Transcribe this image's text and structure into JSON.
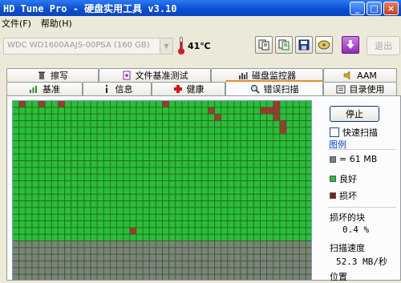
{
  "window": {
    "title": "HD Tune Pro - 硬盘实用工具 v3.10",
    "min": "_",
    "max": "□",
    "close": "×"
  },
  "menu": [
    "文件(F)",
    "帮助(H)"
  ],
  "toolbar": {
    "drive": "WDC WD1600AAJS-00PSA (160 GB)",
    "temperature": "41℃",
    "exit_label": "退出",
    "buttons": [
      "copy-icon",
      "copy-alt-icon",
      "save-icon",
      "disk-info-icon",
      "download-icon"
    ]
  },
  "tabs": {
    "back": [
      {
        "label": "擦写",
        "icon": "trash-icon"
      },
      {
        "label": "文件基准测试",
        "icon": "file-test-icon"
      },
      {
        "label": "磁盘监控器",
        "icon": "monitor-icon"
      },
      {
        "label": "AAM",
        "icon": "speaker-icon"
      }
    ],
    "front": [
      {
        "label": "基准",
        "icon": "benchmark-icon"
      },
      {
        "label": "信息",
        "icon": "info-icon"
      },
      {
        "label": "健康",
        "icon": "health-icon"
      },
      {
        "label": "错误扫描",
        "icon": "scan-icon",
        "active": true
      },
      {
        "label": "目录使用",
        "icon": "folder-icon"
      }
    ]
  },
  "scan": {
    "stop_label": "停止",
    "quick_scan_label": "快速扫描",
    "quick_scan_checked": false,
    "legend_title": "图例",
    "legend": [
      {
        "label": "= 61 MB",
        "color": "#808080"
      },
      {
        "label": "良好",
        "color": "#26c03a"
      },
      {
        "label": "损坏",
        "color": "#8b1a1a"
      }
    ],
    "damaged_label": "损坏的块",
    "damaged_value": "0.4 %",
    "speed_label": "扫描速度",
    "speed_value": "52.3 MB/秒",
    "position_label": "位置"
  },
  "colors": {
    "good": "#26c03a",
    "bad": "#a83434",
    "unscanned": "#808080",
    "grid": "#2e6a1e"
  },
  "grid_data": {
    "columns": 46,
    "rows": 27,
    "scanned_rows": 21,
    "bad_blocks": [
      [
        0,
        1
      ],
      [
        0,
        4
      ],
      [
        0,
        7
      ],
      [
        0,
        23
      ],
      [
        0,
        40
      ],
      [
        1,
        30
      ],
      [
        1,
        38
      ],
      [
        1,
        39
      ],
      [
        1,
        40
      ],
      [
        2,
        31
      ],
      [
        2,
        40
      ],
      [
        3,
        41
      ],
      [
        4,
        41
      ],
      [
        19,
        18
      ]
    ]
  }
}
